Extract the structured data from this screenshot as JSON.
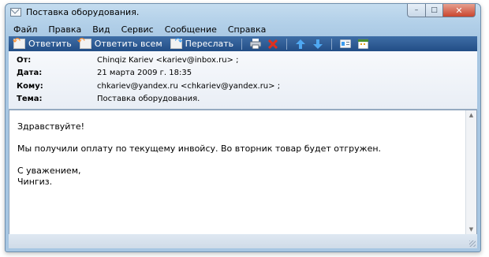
{
  "window": {
    "title": "Поставка оборудования.",
    "controls": {
      "minimize": "–",
      "maximize": "□",
      "close": "✕"
    }
  },
  "menu": [
    "Файл",
    "Правка",
    "Вид",
    "Сервис",
    "Сообщение",
    "Справка"
  ],
  "toolbar": {
    "reply": "Ответить",
    "reply_all": "Ответить всем",
    "forward": "Переслать",
    "icons": [
      "printer-icon",
      "delete-icon",
      "previous-icon",
      "next-icon",
      "address-book-icon",
      "calendar-icon"
    ]
  },
  "headers": {
    "from_label": "От:",
    "from_value": "Chinqiz Kariev <kariev@inbox.ru> ;",
    "date_label": "Дата:",
    "date_value": "21 марта 2009 г. 18:35",
    "to_label": "Кому:",
    "to_value": "chkariev@yandex.ru <chkariev@yandex.ru> ;",
    "subject_label": "Тема:",
    "subject_value": "Поставка оборудования."
  },
  "message": {
    "greeting": "Здравствуйте!",
    "line1": "Мы получили оплату по текущему инвойсу. Во вторник товар будет отгружен.",
    "closing": "С уважением,",
    "signature": "Чингиз."
  },
  "colors": {
    "toolbar": "#224d86",
    "frame": "#b1cfe8",
    "accent_orange": "#ff8a24",
    "accent_blue": "#3a9bf0"
  }
}
